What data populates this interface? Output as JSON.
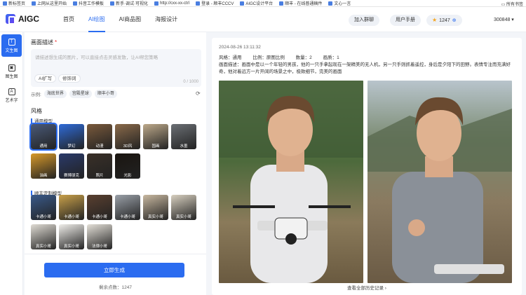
{
  "bookmarks": [
    {
      "label": "新标签页"
    },
    {
      "label": "上网从这里开始"
    },
    {
      "label": "抖音工作模板"
    },
    {
      "label": "新手·调试·可视化"
    },
    {
      "label": "http://cxx-xx-ctrl"
    },
    {
      "label": "登录 - 顺丰CCCV"
    },
    {
      "label": "AIGC设计平台"
    },
    {
      "label": "顺丰 - 在线普通稿件"
    },
    {
      "label": "文心一言"
    }
  ],
  "bookmarks_right": "所有书签",
  "app": {
    "logo": "AIGC"
  },
  "nav": [
    {
      "label": "首页"
    },
    {
      "label": "AI绘图"
    },
    {
      "label": "AI商品图"
    },
    {
      "label": "海报设计"
    }
  ],
  "header": {
    "join_group": "加入群聊",
    "user_manual": "用户手册",
    "points": "1247",
    "user_id": "300848"
  },
  "rail": [
    {
      "label": "文生图",
      "icon": "T"
    },
    {
      "label": "图生图",
      "icon": "▣"
    },
    {
      "label": "艺术字",
      "icon": "A"
    }
  ],
  "left": {
    "prompt_title": "画面描述",
    "prompt_placeholder": "请描述想生成的图片，可以直接点击灵感发散，让AI帮您策略",
    "counter": "0 / 1000",
    "ai_expand": "AI扩写",
    "modifiers": "修饰词",
    "example_label": "示例:",
    "examples": [
      "海底世界",
      "宫殿星球",
      "顺丰小哥"
    ],
    "style_title": "风格",
    "general_title": "通用模型",
    "styles": [
      {
        "label": "通用",
        "selected": true,
        "color": "#4a5a78"
      },
      {
        "label": "梦幻",
        "selected": false,
        "color": "#2f6bd8"
      },
      {
        "label": "动漫",
        "selected": false,
        "color": "#7a5a3c"
      },
      {
        "label": "3D风",
        "selected": false,
        "color": "#8a6a4a"
      },
      {
        "label": "国画",
        "selected": false,
        "color": "#bda98a"
      },
      {
        "label": "水墨",
        "selected": false,
        "color": "#6b6f74"
      },
      {
        "label": "油画",
        "selected": false,
        "color": "#d89a2a"
      },
      {
        "label": "赛博朋克",
        "selected": false,
        "color": "#2a3a6a"
      },
      {
        "label": "照片",
        "selected": false,
        "color": "#3a3028"
      },
      {
        "label": "光影",
        "selected": false,
        "color": "#1a1510"
      }
    ],
    "custom_title": "顺丰定制模型",
    "custom": [
      {
        "label": "卡通小哥",
        "color": "#3a5a8a"
      },
      {
        "label": "卡通小哥",
        "color": "#c8a04a"
      },
      {
        "label": "卡通小哥",
        "color": "#5a4030"
      },
      {
        "label": "卡通小哥",
        "color": "#9aa0a8"
      },
      {
        "label": "真实小哥",
        "color": "#c8b8a0"
      },
      {
        "label": "真实小哥",
        "color": "#d8d0c0"
      },
      {
        "label": "真实小哥",
        "color": "#e0dcd4"
      },
      {
        "label": "真实小哥",
        "color": "#f0eeea"
      },
      {
        "label": "法律小哥",
        "color": "#e4e0d8"
      }
    ],
    "generate": "立即生成",
    "balance_label": "剩余点数：",
    "balance_value": "1247"
  },
  "result": {
    "datetime": "2024-08-26 13:11:32",
    "style_label": "风格：通用",
    "ratio_label": "比例：原图比例",
    "count_label": "数量：2",
    "quality_label": "画质：1",
    "description": "画面描述：画面中是以一个年轻的男孩，他的一只手拿起现在一架精美的无人机，另一只手则抓着遥控，身后是夕阳下的田野。表情专注而充满好奇，他对着远方一片开阔的场景之中，极致细节，完美的画面",
    "history_link": "查看全部历史记录 ›",
    "images": [
      "男孩手持无人机",
      "男孩与无人机"
    ]
  }
}
